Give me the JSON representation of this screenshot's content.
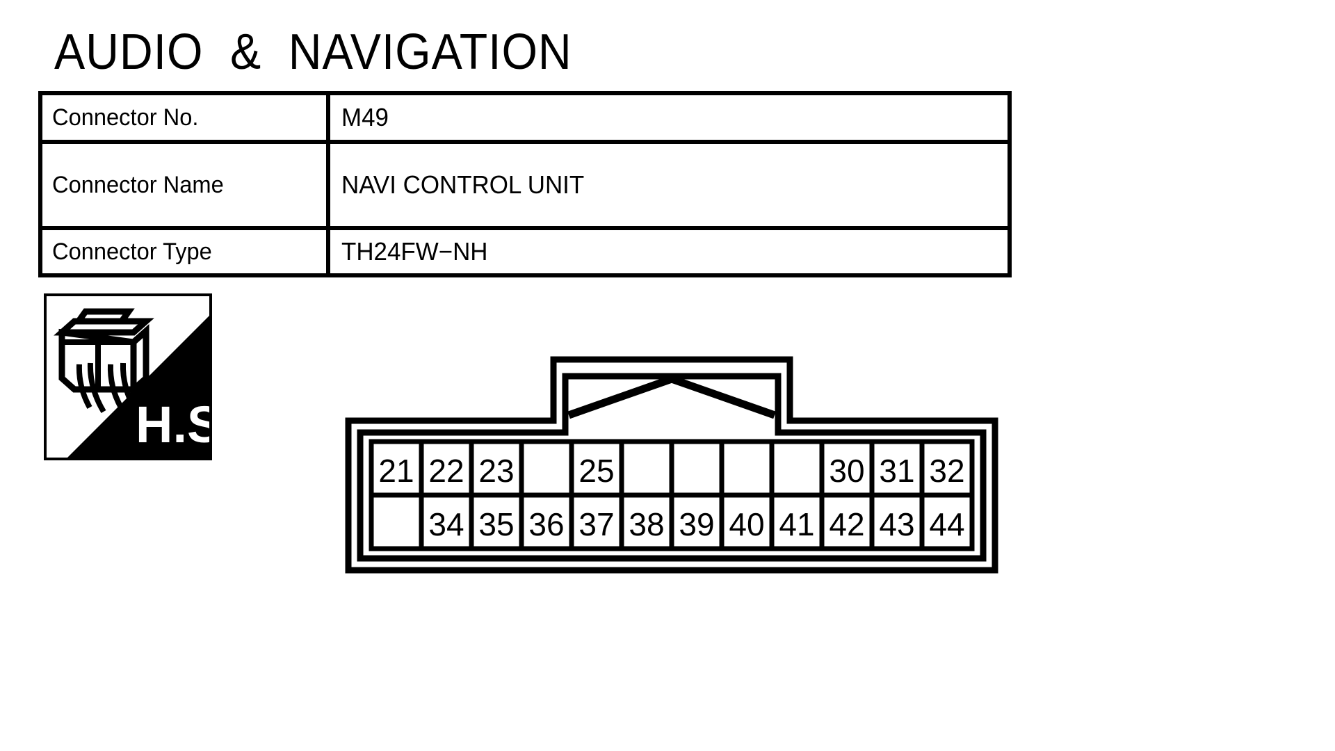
{
  "title": "AUDIO  &  NAVIGATION",
  "info_table": {
    "rows": [
      {
        "label": "Connector No.",
        "value": "M49"
      },
      {
        "label": "Connector Name",
        "value": "NAVI CONTROL UNIT"
      },
      {
        "label": "Connector Type",
        "value": "TH24FW−NH"
      }
    ]
  },
  "hs_badge": {
    "label": "H.S.",
    "icon_name": "connector-with-wires-icon",
    "triangle_color": "#000000",
    "background_color": "#ffffff"
  },
  "connector": {
    "top_row": [
      "21",
      "22",
      "23",
      "",
      "25",
      "",
      "",
      "",
      "",
      "30",
      "31",
      "32"
    ],
    "bottom_row": [
      "",
      "34",
      "35",
      "36",
      "37",
      "38",
      "39",
      "40",
      "41",
      "42",
      "43",
      "44"
    ],
    "stroke_color": "#000000",
    "fill_color": "#ffffff"
  }
}
